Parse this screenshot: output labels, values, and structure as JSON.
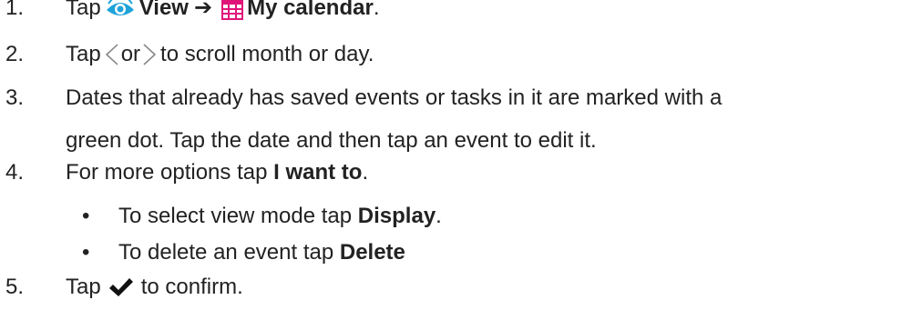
{
  "steps": [
    {
      "num": "1.",
      "pre": "Tap",
      "bold1": "View",
      "arrow": "➔",
      "bold2": "My calendar",
      "post": "."
    },
    {
      "num": "2.",
      "pre": "Tap",
      "mid": "or",
      "post": "to scroll month or day."
    },
    {
      "num": "3.",
      "line1": "Dates that already has saved events or tasks in it are marked with a",
      "line2": "green dot. Tap the date and then tap an event to edit it."
    },
    {
      "num": "4.",
      "pre": "For more options tap",
      "bold": "I want to",
      "post": "."
    },
    {
      "num": "5.",
      "pre": "Tap",
      "post": "to confirm."
    }
  ],
  "substeps": [
    {
      "bullet": "•",
      "pre": "To select view mode tap",
      "bold": "Display",
      "post": "."
    },
    {
      "bullet": "•",
      "pre": "To delete an event tap",
      "bold": "Delete",
      "post": ""
    }
  ],
  "icons": {
    "view": "eye-icon",
    "calendar": "calendar-icon",
    "left": "chevron-left-icon",
    "right": "chevron-right-icon",
    "check": "checkmark-icon"
  },
  "colors": {
    "text": "#222222",
    "eye_blue": "#1fa3d9",
    "calendar_pink": "#e0157a",
    "chevron": "#888888",
    "check": "#111111"
  }
}
